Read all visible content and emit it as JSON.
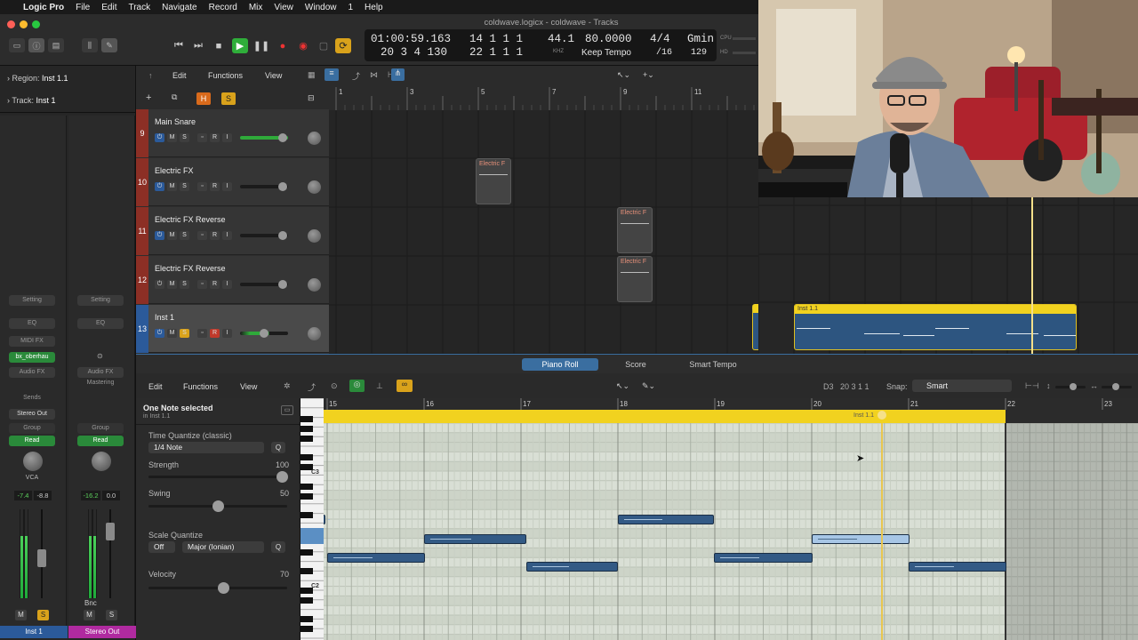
{
  "menubar": {
    "items": [
      "Logic Pro",
      "File",
      "Edit",
      "Track",
      "Navigate",
      "Record",
      "Mix",
      "View",
      "Window",
      "1",
      "Help"
    ]
  },
  "window": {
    "title": "coldwave.logicx - coldwave - Tracks"
  },
  "lcd": {
    "time": "01:00:59.163",
    "bars_top": "14 1 1 1",
    "bars_bottom": "20 3 4 130",
    "bars_bottom2": "22 1 1 1",
    "rate": "44.1",
    "rate_unit": "KHZ",
    "tempo": "80.0000",
    "tempo_mode": "Keep Tempo",
    "sig": "4/4",
    "division": "/16",
    "key": "Gmin",
    "key_num": "129",
    "cpu_label": "CPU",
    "hd_label": "HD"
  },
  "inspector": {
    "region_label": "Region:",
    "region_value": "Inst 1.1",
    "track_label": "Track:",
    "track_value": "Inst 1",
    "strip1": {
      "setting": "Setting",
      "eq": "EQ",
      "midifx": "MIDI FX",
      "instrument": "bx_oberhau",
      "audiofx": "Audio FX",
      "sends": "Sends",
      "output": "Stereo Out",
      "group": "Group",
      "automation": "Read",
      "vca": "VCA",
      "vol": "-7.4",
      "peak": "-8.8",
      "m": "M",
      "s": "S",
      "name": "Inst 1"
    },
    "strip2": {
      "setting": "Setting",
      "eq": "EQ",
      "audiofx": "Audio FX",
      "mastering": "Mastering",
      "group": "Group",
      "automation": "Read",
      "vol": "-16.2",
      "peak": "0.0",
      "bnc": "Bnc",
      "m": "M",
      "s": "S",
      "name": "Stereo Out"
    }
  },
  "tracks_header": {
    "edit": "Edit",
    "functions": "Functions",
    "view": "View"
  },
  "track_buttons": {
    "h": "H",
    "s": "S"
  },
  "tracks": [
    {
      "num": "9",
      "name": "Main Snare"
    },
    {
      "num": "10",
      "name": "Electric FX"
    },
    {
      "num": "11",
      "name": "Electric FX Reverse"
    },
    {
      "num": "12",
      "name": "Electric FX Reverse"
    },
    {
      "num": "13",
      "name": "Inst 1"
    }
  ],
  "track_btn_labels": {
    "m": "M",
    "s": "S",
    "r": "R",
    "i": "I"
  },
  "arrange_ruler": [
    "1",
    "3",
    "5",
    "7",
    "9",
    "11"
  ],
  "regions": {
    "electric1": "Electric F",
    "electric2": "Electric F",
    "electric3": "Electric F",
    "inst": "Inst 1.1"
  },
  "editor_tabs": [
    "Piano Roll",
    "Score",
    "Smart Tempo"
  ],
  "pr_toolbar": {
    "edit": "Edit",
    "functions": "Functions",
    "view": "View",
    "note_pos": "D3",
    "note_pos2": "20 3 1 1",
    "snap_label": "Snap:",
    "snap_value": "Smart"
  },
  "pr_left": {
    "selection": "One Note selected",
    "selection_sub": "in Inst 1.1",
    "tq_label": "Time Quantize (classic)",
    "tq_value": "1/4 Note",
    "q": "Q",
    "strength_label": "Strength",
    "strength_value": "100",
    "swing_label": "Swing",
    "swing_value": "50",
    "sq_label": "Scale Quantize",
    "sq_off": "Off",
    "sq_scale": "Major (Ionian)",
    "velocity_label": "Velocity",
    "velocity_value": "70"
  },
  "keyboard": {
    "c3": "C3",
    "c2": "C2"
  },
  "pr_ruler": [
    "15",
    "16",
    "17",
    "18",
    "19",
    "20",
    "21",
    "22",
    "23"
  ],
  "pr_region_label": "Inst 1.1"
}
